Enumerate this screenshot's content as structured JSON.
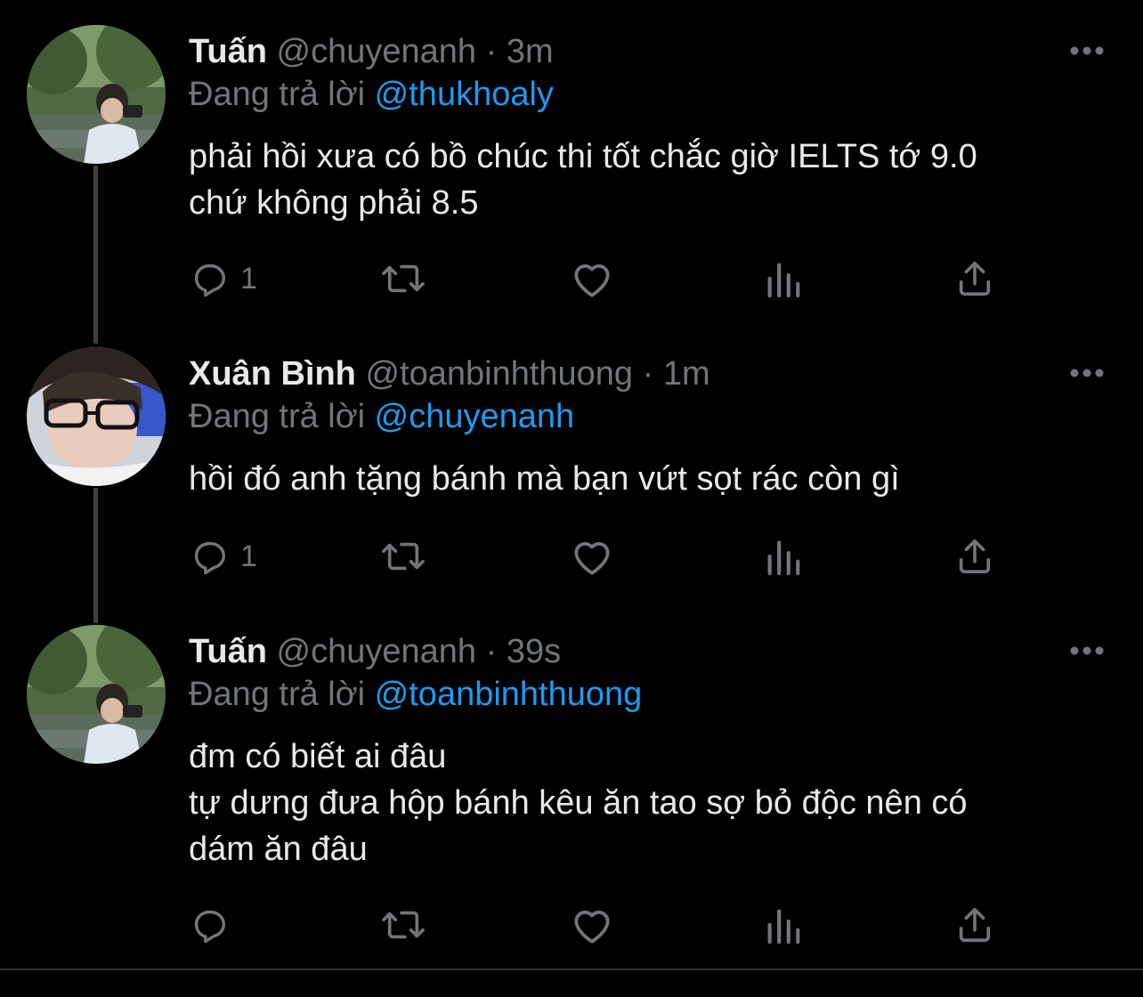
{
  "theme": {
    "background": "#000000",
    "text": "#e7e9ea",
    "muted": "#71767b",
    "accent": "#1d9bf0"
  },
  "tweets": [
    {
      "display_name": "Tuấn",
      "handle": "@chuyenanh",
      "separator": "·",
      "time": "3m",
      "reply_prefix": "Đang trả lời",
      "reply_to": "@thukhoaly",
      "text": "phải hồi xưa có bồ chúc thi tốt chắc giờ IELTS tớ 9.0\nchứ không phải 8.5",
      "reply_count": "1",
      "icons": [
        "reply-icon",
        "retweet-icon",
        "like-icon",
        "analytics-icon",
        "share-icon",
        "more-icon"
      ]
    },
    {
      "display_name": "Xuân Bình",
      "handle": "@toanbinhthuong",
      "separator": "·",
      "time": "1m",
      "reply_prefix": "Đang trả lời",
      "reply_to": "@chuyenanh",
      "text": "hồi đó anh tặng bánh mà bạn vứt sọt rác còn gì",
      "reply_count": "1",
      "icons": [
        "reply-icon",
        "retweet-icon",
        "like-icon",
        "analytics-icon",
        "share-icon",
        "more-icon"
      ]
    },
    {
      "display_name": "Tuấn",
      "handle": "@chuyenanh",
      "separator": "·",
      "time": "39s",
      "reply_prefix": "Đang trả lời",
      "reply_to": "@toanbinhthuong",
      "text": "đm có biết ai đâu\ntự dưng đưa hộp bánh kêu ăn tao sợ bỏ độc nên có\ndám ăn đâu",
      "reply_count": "",
      "icons": [
        "reply-icon",
        "retweet-icon",
        "like-icon",
        "analytics-icon",
        "share-icon",
        "more-icon"
      ]
    }
  ]
}
